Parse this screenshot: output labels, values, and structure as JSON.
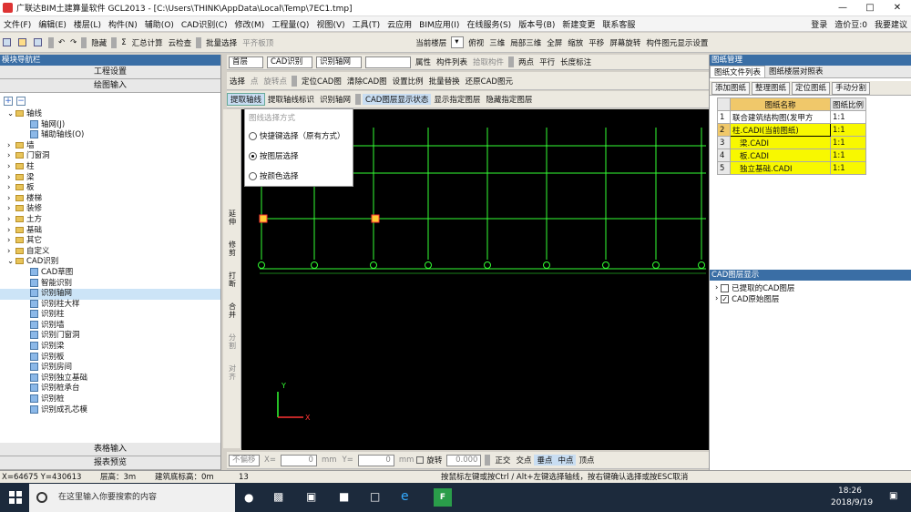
{
  "title": "广联达BIM土建算量软件 GCL2013 - [C:\\Users\\THINK\\AppData\\Local\\Temp\\7EC1.tmp]",
  "menu": [
    "文件(F)",
    "编辑(E)",
    "楼层(L)",
    "构件(N)",
    "辅助(O)",
    "CAD识别(C)",
    "修改(M)",
    "工程量(Q)",
    "视图(V)",
    "工具(T)",
    "云应用",
    "BIM应用(I)",
    "在线服务(S)",
    "版本号(B)",
    "新建变更",
    "联系客服"
  ],
  "menu_right": {
    "login": "登录",
    "price": "造价豆:0",
    "suggest": "我要建议"
  },
  "toolbar1": {
    "hide": "隐藏",
    "sum": "汇总计算",
    "cloud_check": "云检查",
    "batch_select": "批量选择",
    "align_top": "平齐板顶",
    "current_floor": "当前楼层",
    "top_view": "俯视",
    "three_d": "三维",
    "local_3d": "局部三维",
    "fullscreen": "全屏",
    "zoom": "缩放",
    "pan": "平移",
    "screen_rotate": "屏幕旋转",
    "display_settings": "构件图元显示设置"
  },
  "toolbar2": {
    "floor": "首层",
    "cad_recognize": "CAD识别",
    "recognize_axis": "识别轴网",
    "attributes": "属性",
    "component_list": "构件列表",
    "pick_component": "拾取构件",
    "two_points": "两点",
    "parallel": "平行",
    "length_label": "长度标注"
  },
  "toolbar3": {
    "select": "选择",
    "point": "点",
    "rotate_point": "旋转点",
    "locate_cad": "定位CAD图",
    "clear_cad": "清除CAD图",
    "set_ratio": "设置比例",
    "batch_replace": "批量替换",
    "restore_cad": "还原CAD图元"
  },
  "toolbar4": {
    "extract_axis": "提取轴线",
    "extract_axis_label": "提取轴线标识",
    "recognize_axis": "识别轴网",
    "layer_status": "CAD图层显示状态",
    "show_layer": "显示指定图层",
    "hide_layer": "隐藏指定图层"
  },
  "left_panel": {
    "title": "模块导航栏",
    "project_settings": "工程设置",
    "drawing_input": "绘图输入",
    "table_input": "表格输入",
    "report_preview": "报表预览",
    "tree": [
      {
        "label": "轴线",
        "level": 0,
        "kind": "folder",
        "open": true
      },
      {
        "label": "轴网(J)",
        "level": 1,
        "kind": "leaf"
      },
      {
        "label": "辅助轴线(O)",
        "level": 1,
        "kind": "leaf"
      },
      {
        "label": "墙",
        "level": 0,
        "kind": "folder"
      },
      {
        "label": "门窗洞",
        "level": 0,
        "kind": "folder"
      },
      {
        "label": "柱",
        "level": 0,
        "kind": "folder"
      },
      {
        "label": "梁",
        "level": 0,
        "kind": "folder"
      },
      {
        "label": "板",
        "level": 0,
        "kind": "folder"
      },
      {
        "label": "楼梯",
        "level": 0,
        "kind": "folder"
      },
      {
        "label": "装修",
        "level": 0,
        "kind": "folder"
      },
      {
        "label": "土方",
        "level": 0,
        "kind": "folder"
      },
      {
        "label": "基础",
        "level": 0,
        "kind": "folder"
      },
      {
        "label": "其它",
        "level": 0,
        "kind": "folder"
      },
      {
        "label": "自定义",
        "level": 0,
        "kind": "folder"
      },
      {
        "label": "CAD识别",
        "level": 0,
        "kind": "folder",
        "open": true
      },
      {
        "label": "CAD草图",
        "level": 1,
        "kind": "leaf"
      },
      {
        "label": "智能识别",
        "level": 1,
        "kind": "leaf"
      },
      {
        "label": "识别轴网",
        "level": 1,
        "kind": "leaf",
        "selected": true
      },
      {
        "label": "识别柱大样",
        "level": 1,
        "kind": "leaf"
      },
      {
        "label": "识别柱",
        "level": 1,
        "kind": "leaf"
      },
      {
        "label": "识别墙",
        "level": 1,
        "kind": "leaf"
      },
      {
        "label": "识别门窗洞",
        "level": 1,
        "kind": "leaf"
      },
      {
        "label": "识别梁",
        "level": 1,
        "kind": "leaf"
      },
      {
        "label": "识别板",
        "level": 1,
        "kind": "leaf"
      },
      {
        "label": "识别房间",
        "level": 1,
        "kind": "leaf"
      },
      {
        "label": "识别独立基础",
        "level": 1,
        "kind": "leaf"
      },
      {
        "label": "识别桩承台",
        "level": 1,
        "kind": "leaf"
      },
      {
        "label": "识别桩",
        "level": 1,
        "kind": "leaf"
      },
      {
        "label": "识别成孔芯模",
        "level": 1,
        "kind": "leaf"
      }
    ]
  },
  "vertical_tools": [
    "延伸",
    "修剪",
    "打断",
    "合并",
    "分割",
    "对齐"
  ],
  "popup": {
    "title": "图线选择方式",
    "options": [
      {
        "label": "快捷键选择（原有方式）",
        "selected": false
      },
      {
        "label": "按图层选择",
        "selected": true
      },
      {
        "label": "按颜色选择",
        "selected": false
      }
    ]
  },
  "right_panel": {
    "title": "图纸管理",
    "tabs": [
      "图纸文件列表",
      "图纸楼层对照表"
    ],
    "buttons": [
      "添加图纸",
      "整理图纸",
      "定位图纸",
      "手动分割"
    ],
    "headers": [
      "图纸名称",
      "图纸比例"
    ],
    "rows": [
      {
        "num": "1",
        "name": "联合建筑结构图(发甲方",
        "ratio": "1:1",
        "mark": "—"
      },
      {
        "num": "2",
        "name": "柱.CADI(当前图纸)",
        "ratio": "1:1",
        "mark": ""
      },
      {
        "num": "3",
        "name": "梁.CADI",
        "ratio": "1:1",
        "mark": ""
      },
      {
        "num": "4",
        "name": "板.CADI",
        "ratio": "1:1",
        "mark": ""
      },
      {
        "num": "5",
        "name": "独立基础.CADI",
        "ratio": "1:1",
        "mark": ""
      }
    ],
    "layer_title": "CAD图层显示",
    "layers": [
      {
        "label": "已提取的CAD图层",
        "checked": false
      },
      {
        "label": "CAD原始图层",
        "checked": true
      }
    ]
  },
  "bottom_toolbar": {
    "no_offset": "不偏移",
    "x_label": "X=",
    "x_value": "0",
    "mm1": "mm",
    "y_label": "Y=",
    "y_value": "0",
    "mm2": "mm",
    "rotate": "旋转",
    "rotate_value": "0.000",
    "ortho": "正交",
    "intersection": "交点",
    "perpendicular": "垂点",
    "midpoint": "中点",
    "vertex": "顶点"
  },
  "statusbar": {
    "coords": "X=64675 Y=430613",
    "floor_height": "层高：3m",
    "base_elev": "建筑底标高：0m",
    "num": "13",
    "hint": "按鼠标左键或按Ctrl / Alt+左键选择轴线，按右键确认选择或按ESC取消"
  },
  "taskbar": {
    "search_placeholder": "在这里输入你要搜索的内容",
    "time": "18:26",
    "date": "2018/9/19"
  },
  "colors": {
    "canvas": "#000000",
    "cad_line": "#33ff33",
    "axis_circle": "#33ff33",
    "highlight": "#f8f800",
    "selected_tree": "#cce4f7"
  }
}
